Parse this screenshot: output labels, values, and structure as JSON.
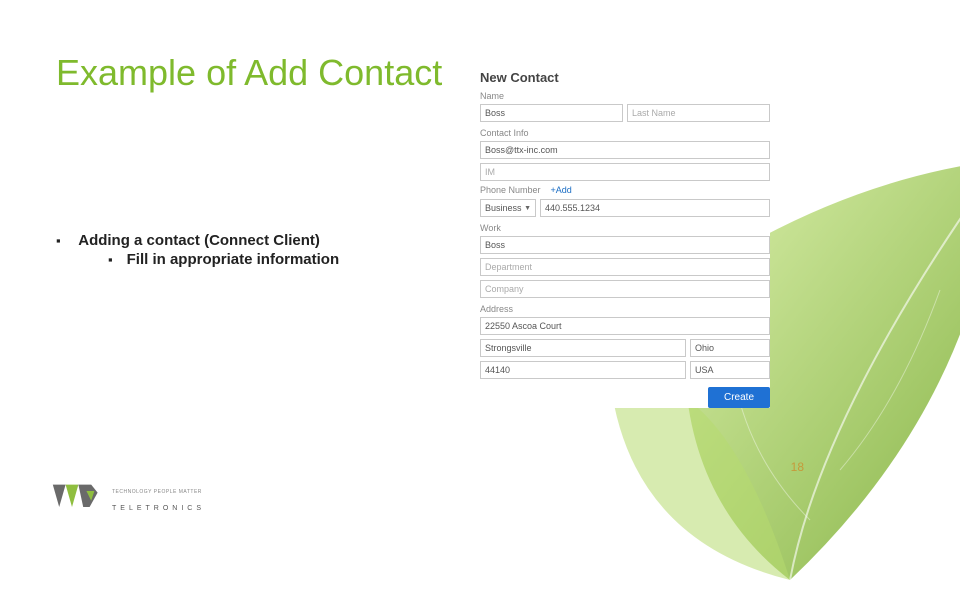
{
  "slide": {
    "title": "Example of Add Contact",
    "page_number": "18"
  },
  "bullets": {
    "l1": "Adding a contact (Connect Client)",
    "l2": "Fill in appropriate information"
  },
  "form": {
    "heading": "New Contact",
    "sections": {
      "name": "Name",
      "contact_info": "Contact Info",
      "phone": "Phone Number",
      "work": "Work",
      "address": "Address"
    },
    "fields": {
      "first_name": "Boss",
      "last_name_placeholder": "Last Name",
      "email": "Boss@ttx-inc.com",
      "im_placeholder": "IM",
      "phone_type": "Business",
      "phone_number": "440.555.1234",
      "add_link": "+Add",
      "work_name": "Boss",
      "department_placeholder": "Department",
      "company_placeholder": "Company",
      "street": "22550 Ascoa Court",
      "city": "Strongsville",
      "state": "Ohio",
      "zip": "44140",
      "country": "USA"
    },
    "create_button": "Create"
  },
  "logo": {
    "tagline": "TECHNOLOGY PEOPLE MATTER",
    "name": "TELETRONICS"
  }
}
